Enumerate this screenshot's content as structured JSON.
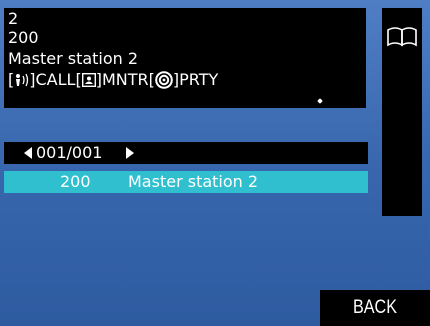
{
  "info": {
    "line1": "2",
    "line2": "200",
    "line3": "Master station 2",
    "status": {
      "call_label": "CALL",
      "mntr_label": "MNTR",
      "prty_label": "PRTY",
      "open_bracket": "[",
      "close_bracket": "]"
    }
  },
  "icons": {
    "book": "book-icon",
    "call": "call-wave-icon",
    "monitor": "monitor-icon",
    "priority": "target-icon"
  },
  "list": {
    "page_indicator": "001/001",
    "rows": [
      {
        "number": "200",
        "name": "Master station 2"
      }
    ]
  },
  "buttons": {
    "back_label": "BACK"
  },
  "colors": {
    "background": "#3867ae",
    "selected_row": "#2fbfcf",
    "panel": "#000000"
  }
}
